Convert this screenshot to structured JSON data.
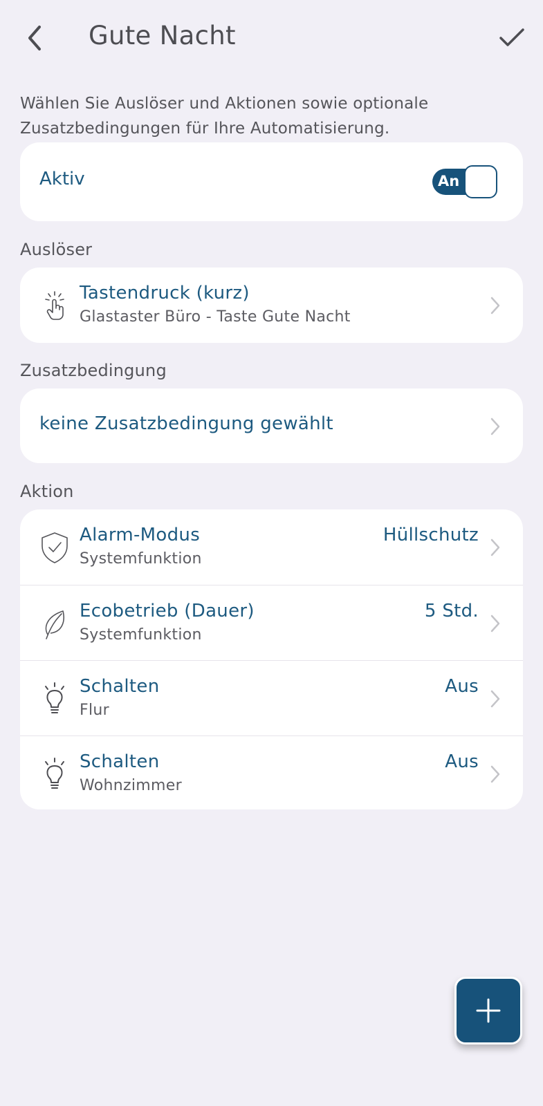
{
  "header": {
    "title": "Gute Nacht",
    "back_icon": "chevron-left-icon",
    "confirm_icon": "checkmark-icon"
  },
  "intro": "Wählen Sie Auslöser und Aktionen sowie optionale Zusatzbedingungen für Ihre Automatisierung.",
  "active": {
    "label": "Aktiv",
    "toggle_text": "An",
    "toggle_on": true
  },
  "trigger": {
    "section_label": "Auslöser",
    "title": "Tastendruck (kurz)",
    "subtitle": "Glastaster Büro - Taste Gute Nacht",
    "icon": "tap-hand-icon"
  },
  "condition": {
    "section_label": "Zusatzbedingung",
    "label": "keine Zusatzbedingung gewählt"
  },
  "actions": {
    "section_label": "Aktion",
    "items": [
      {
        "title": "Alarm-Modus",
        "subtitle": "Systemfunktion",
        "value": "Hüllschutz",
        "icon": "shield-check-icon"
      },
      {
        "title": "Ecobetrieb (Dauer)",
        "subtitle": "Systemfunktion",
        "value": "5 Std.",
        "icon": "leaf-icon"
      },
      {
        "title": "Schalten",
        "subtitle": "Flur",
        "value": "Aus",
        "icon": "lightbulb-icon"
      },
      {
        "title": "Schalten",
        "subtitle": "Wohnzimmer",
        "value": "Aus",
        "icon": "lightbulb-icon"
      }
    ]
  },
  "fab": {
    "icon": "plus-icon"
  },
  "colors": {
    "background": "#f1eff6",
    "accent": "#17527a",
    "text_primary": "#1d5a80",
    "text_secondary": "#5c5c62"
  }
}
